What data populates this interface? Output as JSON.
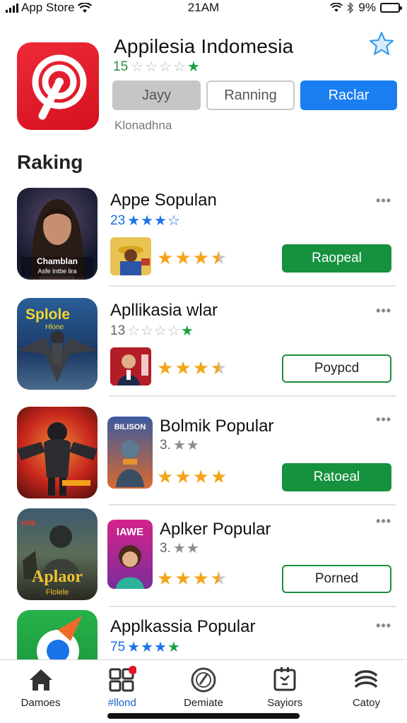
{
  "status_bar": {
    "carrier": "App Store",
    "time": "21AM",
    "battery": "9%",
    "battery_level": 0.09,
    "icons": [
      "signal-icon",
      "wifi-icon",
      "bluetooth-icon",
      "battery-icon"
    ]
  },
  "hero": {
    "title": "Appilesia Indomesia",
    "rating_value": "15",
    "stars": [
      "empty",
      "empty",
      "empty",
      "empty",
      "green"
    ],
    "buttons": [
      "Jayy",
      "Ranning",
      "Raclar"
    ],
    "subtitle": "Klonadhna",
    "icon": "app-logo-icon",
    "accent": "#e31b2b"
  },
  "section": {
    "title": "Raking"
  },
  "rows": [
    {
      "title": "Appe Sopulan",
      "rating_value": "23",
      "rating_color": "blue",
      "stars": [
        "blue",
        "blue",
        "blue",
        "empty-blue"
      ],
      "gold_stars": 3.5,
      "action": "Raopeal",
      "action_style": "solid",
      "icon_caption": "Chamblan",
      "icon_caption_2": "Asfe Intbe lira"
    },
    {
      "title": "Apllikasia wlar",
      "rating_value": "13",
      "rating_color": "gray",
      "stars": [
        "empty",
        "empty",
        "empty",
        "empty",
        "green"
      ],
      "gold_stars": 3.5,
      "action": "Poypcd",
      "action_style": "outline",
      "icon_caption": "Splole",
      "icon_caption_2": "Hlone"
    },
    {
      "title": "Bolmik Popular",
      "rating_value": "3.",
      "rating_color": "gray",
      "stars": [
        "gray",
        "gray"
      ],
      "gold_stars": 4,
      "action": "Ratoeal",
      "action_style": "solid",
      "icon_caption": "",
      "icon_caption_2": "",
      "thumb_caption": "BILISON"
    },
    {
      "title": "Aplker Popular",
      "rating_value": "3.",
      "rating_color": "gray",
      "stars": [
        "gray",
        "gray"
      ],
      "gold_stars": 3.5,
      "action": "Porned",
      "action_style": "outline",
      "icon_caption": "Aplaor",
      "icon_caption_2": "Flolele",
      "thumb_caption": "IAWE"
    },
    {
      "title": "Applkassia Popular",
      "rating_value": "75",
      "rating_color": "blue",
      "stars": [
        "blue",
        "blue",
        "blue",
        "green"
      ],
      "gold_stars": 0,
      "action": "",
      "action_style": "none",
      "icon_caption": "",
      "icon_caption_2": ""
    }
  ],
  "tabs": [
    {
      "label": "Damoes",
      "icon": "home-icon",
      "active": false
    },
    {
      "label": "#llond",
      "icon": "grid-apps-icon",
      "active": true
    },
    {
      "label": "Demiate",
      "icon": "at-sign-icon",
      "active": false
    },
    {
      "label": "Sayiors",
      "icon": "schedule-icon",
      "active": false
    },
    {
      "label": "Catoy",
      "icon": "layers-icon",
      "active": false
    }
  ],
  "colors": {
    "green": "#16923f",
    "blue": "#1a7ef0",
    "gold": "#f4a418",
    "star_green": "#19a340"
  }
}
